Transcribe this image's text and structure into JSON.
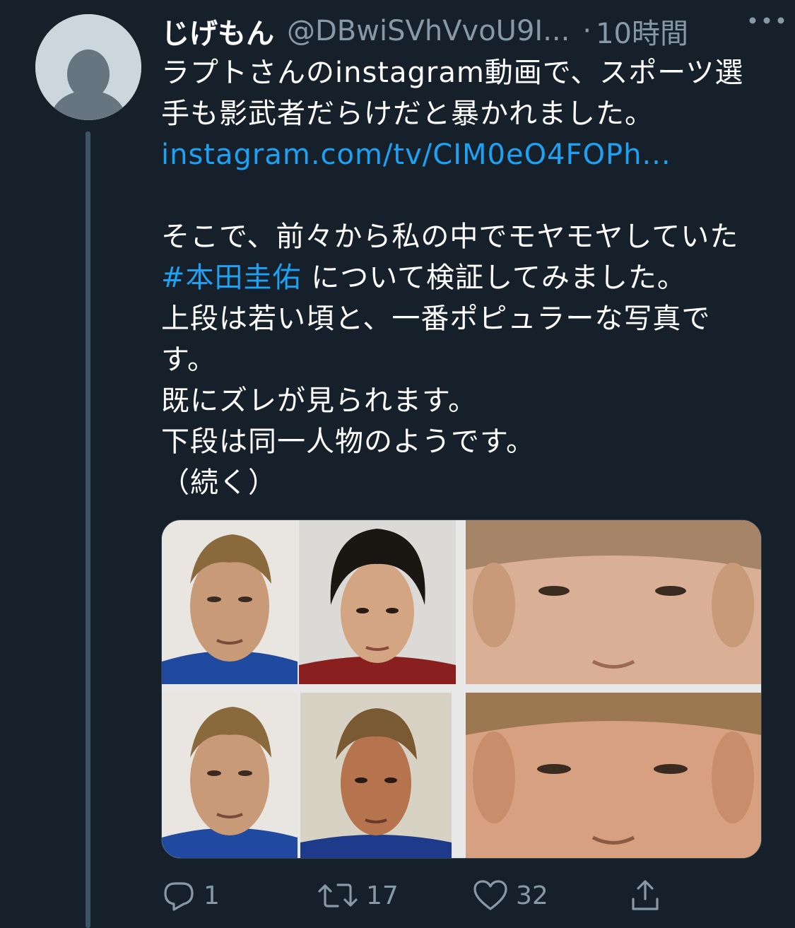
{
  "tweet": {
    "author_name": "じげもん",
    "handle": "@DBwiSVhVvoU9I...",
    "separator": "·",
    "time": "10時間",
    "lines": {
      "l1": "ラプトさんのinstagram動画で、スポーツ選",
      "l2": "手も影武者だらけだと暴かれました。",
      "link": "instagram.com/tv/CIM0eO4FOPh...",
      "l4": "そこで、前々から私の中でモヤモヤしていた",
      "hashtag": "#本田圭佑",
      "l5_rest": " について検証してみました。",
      "l6": "上段は若い頃と、一番ポピュラーな写真で",
      "l7": "す。",
      "l8": "既にズレが見られます。",
      "l9": "下段は同一人物のようです。",
      "l10": "（続く）"
    },
    "actions": {
      "reply_count": "1",
      "retweet_count": "17",
      "like_count": "32"
    },
    "icons": [
      "avatar-placeholder",
      "more-icon",
      "reply-icon",
      "retweet-icon",
      "like-icon",
      "share-icon"
    ],
    "colors": {
      "background": "#15202b",
      "link": "#1da1f2",
      "secondary": "#8899a6"
    }
  }
}
